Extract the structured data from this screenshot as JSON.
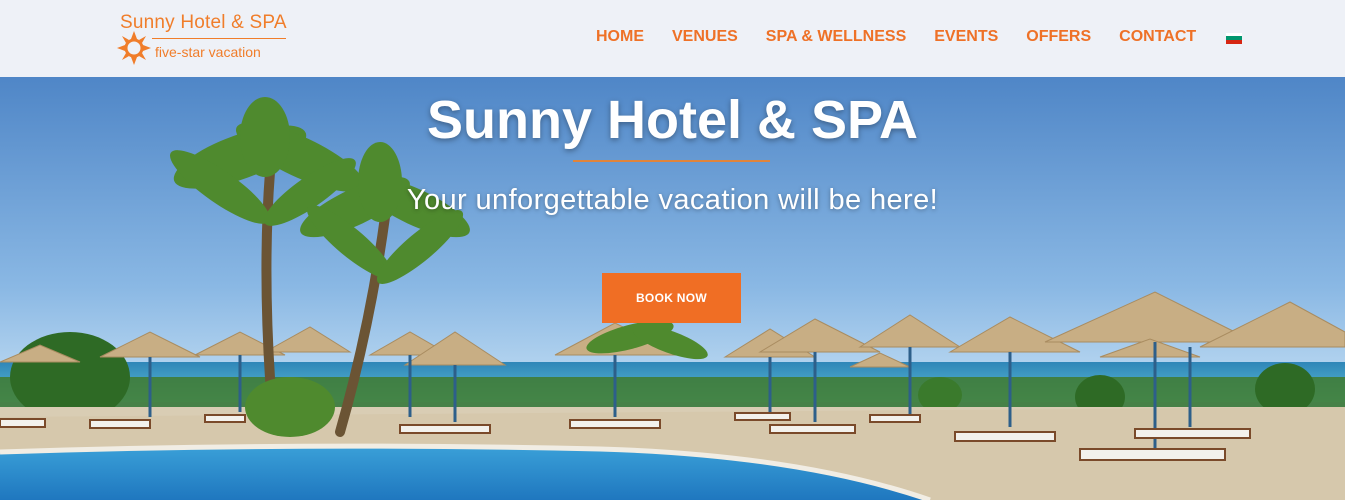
{
  "logo": {
    "title": "Sunny Hotel & SPA",
    "tagline": "five-star vacation",
    "icon": "sun-icon"
  },
  "nav": {
    "items": [
      {
        "label": "HOME"
      },
      {
        "label": "VENUES"
      },
      {
        "label": "SPA & WELLNESS"
      },
      {
        "label": "EVENTS"
      },
      {
        "label": "OFFERS"
      },
      {
        "label": "CONTACT"
      }
    ],
    "language_flag": "bulgarian-flag-icon",
    "flag_colors": [
      "#ffffff",
      "#00966e",
      "#d62612"
    ]
  },
  "hero": {
    "title": "Sunny Hotel & SPA",
    "subtitle": "Your unforgettable vacation will be here!",
    "cta_label": "BOOK NOW"
  },
  "colors": {
    "accent": "#f06e24",
    "header_bg": "#eef1f7"
  }
}
